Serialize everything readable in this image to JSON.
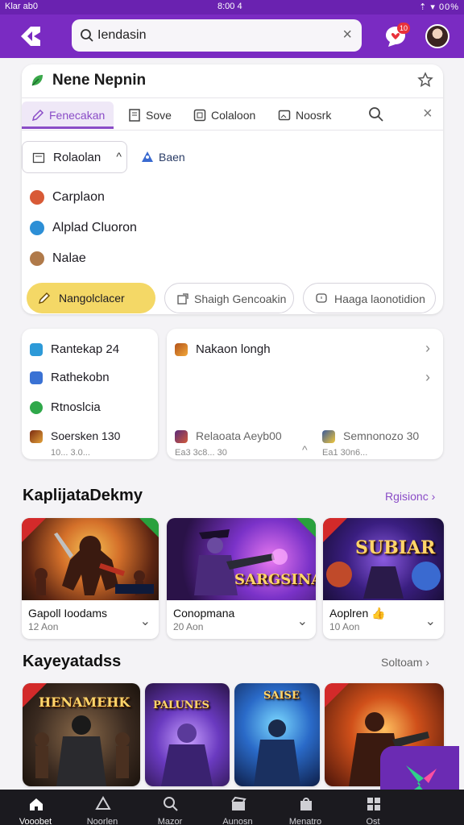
{
  "status": {
    "left": "Klar ab0",
    "center": "8:00 4",
    "right": "00%"
  },
  "search": {
    "value": "Iendasin",
    "clear": "×"
  },
  "chat": {
    "badge": "10"
  },
  "panel": {
    "title": "Nene Nepnin",
    "tabs": [
      {
        "label": "Fenecakan",
        "icon": "pencil-icon"
      },
      {
        "label": "Sove",
        "icon": "document-icon"
      },
      {
        "label": "Colaloon",
        "icon": "frame-icon"
      },
      {
        "label": "Noosrk",
        "icon": "image-icon"
      }
    ],
    "select": {
      "label": "Rolaolan",
      "chevron": "^"
    },
    "baen": "Baen",
    "options": [
      "Carplaon",
      "Alplad Cluoron",
      "Nalae"
    ],
    "pills": [
      {
        "label": "Nangolclacer",
        "icon": "pencil-icon",
        "color": "#f4d866"
      },
      {
        "label": "Shaigh Gencoakin",
        "icon": "share-icon"
      },
      {
        "label": "Haaga laonotidion",
        "icon": "chat-icon"
      }
    ]
  },
  "left_card": {
    "rows": [
      "Rantekap 24",
      "Rathekobn",
      "Rtnoslcia",
      "Soersken 130"
    ],
    "sub": "10... 3.0..."
  },
  "right_card": {
    "header": "Nakaon longh",
    "footer": [
      {
        "label": "Relaoata Aeyb00",
        "sub": "Ea3 3c8... 30"
      },
      {
        "label": "Semnonozo 30",
        "sub": "Ea1 30n6..."
      }
    ]
  },
  "section1": {
    "title": "KaplijataDekmy",
    "link": "Rgisionc",
    "games": [
      {
        "name": "Gapoll Ioodams",
        "sub": "12 Aon",
        "art": ""
      },
      {
        "name": "Conopmana",
        "sub": "20 Aon",
        "art": "SARGSINAIS"
      },
      {
        "name": "Aoplren",
        "sub": "10 Aon",
        "art": "SUBIAR"
      }
    ]
  },
  "section2": {
    "title": "Kayeyatadss",
    "link": "Soltoam",
    "games": [
      {
        "art": "HENAMEHK"
      },
      {
        "art": "PALUNES"
      },
      {
        "art": "SAISE"
      },
      {
        "art": ""
      }
    ]
  },
  "nav": [
    "Vooobet",
    "Noorlen",
    "Mazor",
    "Aunosn",
    "Menatro",
    "Ost"
  ],
  "colors": {
    "brand": "#7a2bc2",
    "accent": "#8a4cc7",
    "pill_yellow": "#f4d866"
  }
}
